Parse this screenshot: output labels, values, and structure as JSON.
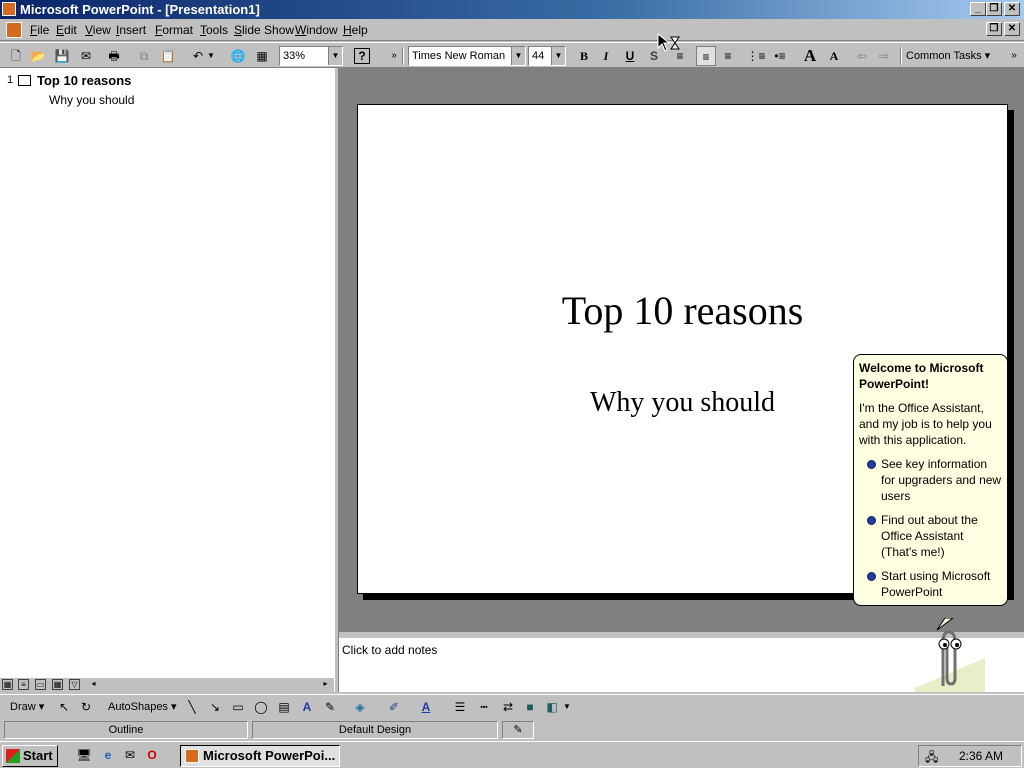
{
  "window": {
    "title": "Microsoft PowerPoint - [Presentation1]"
  },
  "menu": [
    "File",
    "Edit",
    "View",
    "Insert",
    "Format",
    "Tools",
    "Slide Show",
    "Window",
    "Help"
  ],
  "toolbar": {
    "zoom": "33%",
    "font_name": "Times New Roman",
    "font_size": "44",
    "bold": "B",
    "italic": "I",
    "underline": "U",
    "shadow": "S",
    "common_tasks": "Common Tasks"
  },
  "outline": {
    "slide_number": "1",
    "title": "Top 10 reasons",
    "subtitle": "Why you should"
  },
  "slide": {
    "title": "Top 10 reasons",
    "subtitle": "Why you should"
  },
  "notes": {
    "placeholder": "Click to add notes"
  },
  "drawbar": {
    "draw": "Draw",
    "autoshapes": "AutoShapes"
  },
  "status": {
    "view": "Outline",
    "design": "Default Design"
  },
  "assistant": {
    "title": "Welcome to Microsoft PowerPoint!",
    "body": "I'm the Office Assistant, and my job is to help you with this application.",
    "options": [
      "See key information for upgraders and new users",
      "Find out about the Office Assistant (That's me!)",
      "Start using Microsoft PowerPoint"
    ]
  },
  "taskbar": {
    "start": "Start",
    "task": "Microsoft PowerPoi...",
    "clock": "2:36 AM"
  }
}
